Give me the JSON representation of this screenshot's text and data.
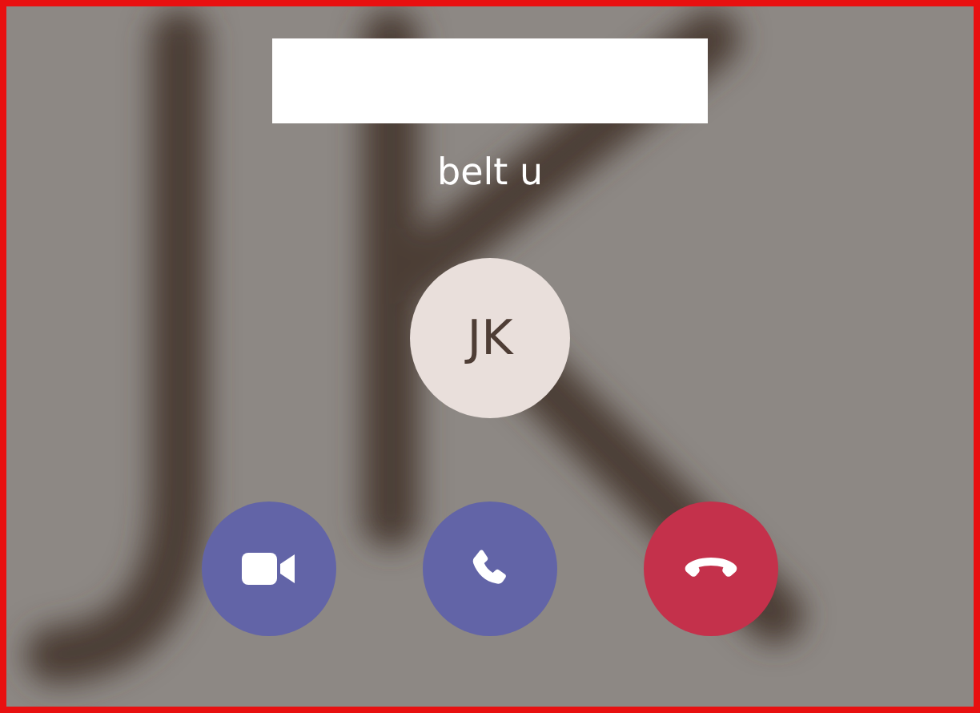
{
  "caller": {
    "subtitle": "belt u",
    "initials": "JK"
  },
  "buttons": [
    {
      "kind": "video"
    },
    {
      "kind": "audio"
    },
    {
      "kind": "decline"
    }
  ]
}
